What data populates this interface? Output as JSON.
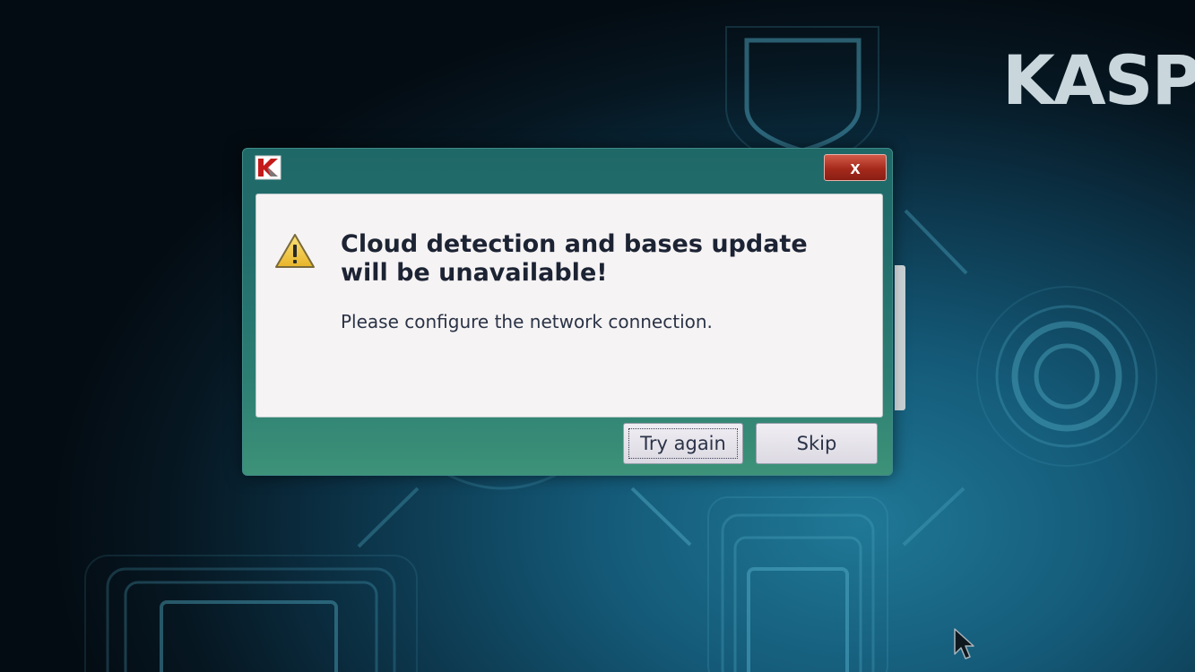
{
  "background": {
    "brand_text": "KASPE"
  },
  "dialog": {
    "app_icon": "kaspersky-k-icon",
    "close_label": "x",
    "warning_icon": "warning-triangle-icon",
    "heading": "Cloud detection and bases update will be unavailable!",
    "message": "Please configure the network connection.",
    "buttons": {
      "try_again": "Try again",
      "skip": "Skip"
    }
  },
  "cursor_icon": "mouse-pointer-icon",
  "colors": {
    "dialog_frame": "#236f6d",
    "content_bg": "#f6f3f4",
    "close_button": "#a52a1c",
    "brand": "#c9d6db",
    "accent_red": "#c41a1a"
  }
}
